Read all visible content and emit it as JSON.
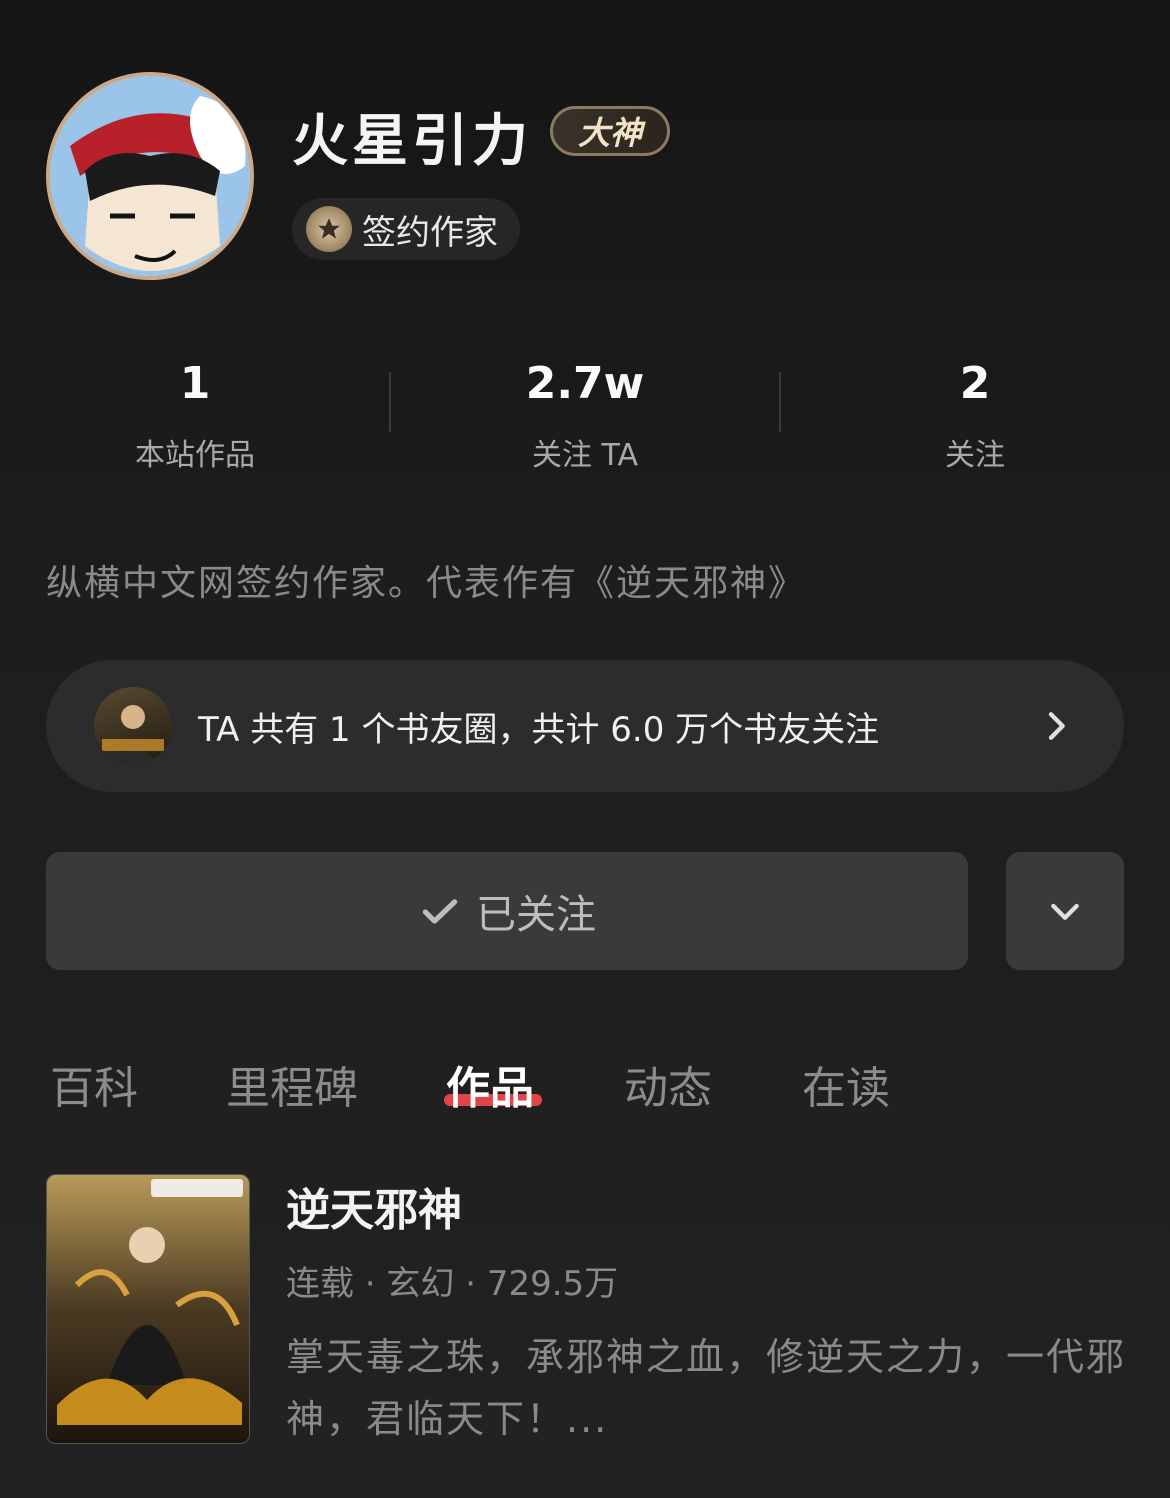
{
  "profile": {
    "name": "火星引力",
    "level_badge": "大神",
    "role_badge": "签约作家"
  },
  "stats": [
    {
      "value": "1",
      "label": "本站作品"
    },
    {
      "value": "2.7w",
      "label": "关注 TA"
    },
    {
      "value": "2",
      "label": "关注"
    }
  ],
  "bio": "纵横中文网签约作家。代表作有《逆天邪神》",
  "fan_circle": {
    "text": "TA 共有 1 个书友圈，共计 6.0 万个书友关注"
  },
  "follow": {
    "label": "已关注"
  },
  "tabs": [
    {
      "label": "百科"
    },
    {
      "label": "里程碑"
    },
    {
      "label": "作品"
    },
    {
      "label": "动态"
    },
    {
      "label": "在读"
    }
  ],
  "active_tab": "作品",
  "book": {
    "title": "逆天邪神",
    "meta": "连载 · 玄幻 · 729.5万",
    "description": "掌天毒之珠，承邪神之血，修逆天之力，一代邪神，君临天下！..."
  },
  "colors": {
    "tab_indicator": "#e0454a",
    "background": "#1d1d1d"
  }
}
